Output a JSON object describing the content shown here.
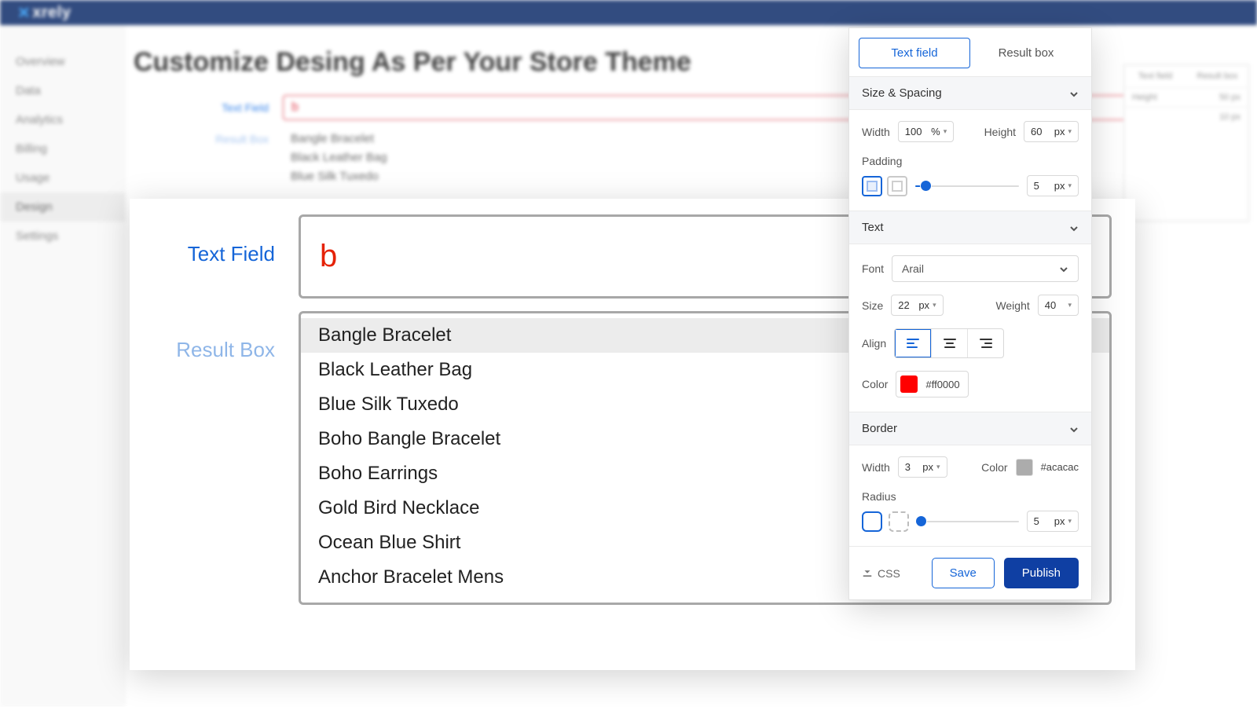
{
  "brand": "xrely",
  "sidebar": {
    "items": [
      "Overview",
      "Data",
      "Analytics",
      "Billing",
      "Usage",
      "Design",
      "Settings"
    ],
    "active_index": 5
  },
  "page": {
    "title": "Customize Desing As Per Your Store Theme",
    "bg_text_field_label": "Text Field",
    "bg_text_field_value": "b",
    "bg_result_box_label": "Result Box",
    "bg_results": [
      "Bangle Bracelet",
      "Black Leather Bag",
      "Blue Silk Tuxedo"
    ],
    "bg_right_tabs": [
      "Text field",
      "Result box"
    ],
    "bg_right_rows": [
      {
        "l": "Height",
        "v": "50",
        "u": "px"
      },
      {
        "l": "",
        "v": "10",
        "u": "px"
      }
    ]
  },
  "preview": {
    "text_field_label": "Text Field",
    "text_field_value": "b",
    "result_box_label": "Result Box",
    "results": [
      "Bangle Bracelet",
      "Black Leather Bag",
      "Blue Silk Tuxedo",
      "Boho Bangle Bracelet",
      "Boho Earrings",
      "Gold Bird Necklace",
      "Ocean Blue Shirt",
      "Anchor Bracelet Mens"
    ],
    "selected_index": 0
  },
  "inspector": {
    "tabs": [
      "Text field",
      "Result box"
    ],
    "active_tab": 0,
    "size_spacing": {
      "title": "Size & Spacing",
      "width_label": "Width",
      "width_value": "100",
      "width_unit": "%",
      "height_label": "Height",
      "height_value": "60",
      "height_unit": "px",
      "padding_label": "Padding",
      "padding_value": "5",
      "padding_unit": "px",
      "padding_slider_pct": 10
    },
    "text": {
      "title": "Text",
      "font_label": "Font",
      "font_value": "Arail",
      "size_label": "Size",
      "size_value": "22",
      "size_unit": "px",
      "weight_label": "Weight",
      "weight_value": "40",
      "align_label": "Align",
      "align_selected": 0,
      "color_label": "Color",
      "color_hex": "#ff0000"
    },
    "border": {
      "title": "Border",
      "width_label": "Width",
      "width_value": "3",
      "width_unit": "px",
      "color_label": "Color",
      "color_hex": "#acacac",
      "radius_label": "Radius",
      "radius_value": "5",
      "radius_unit": "px",
      "radius_slider_pct": 4
    },
    "footer": {
      "css_label": "CSS",
      "save_label": "Save",
      "publish_label": "Publish"
    }
  }
}
